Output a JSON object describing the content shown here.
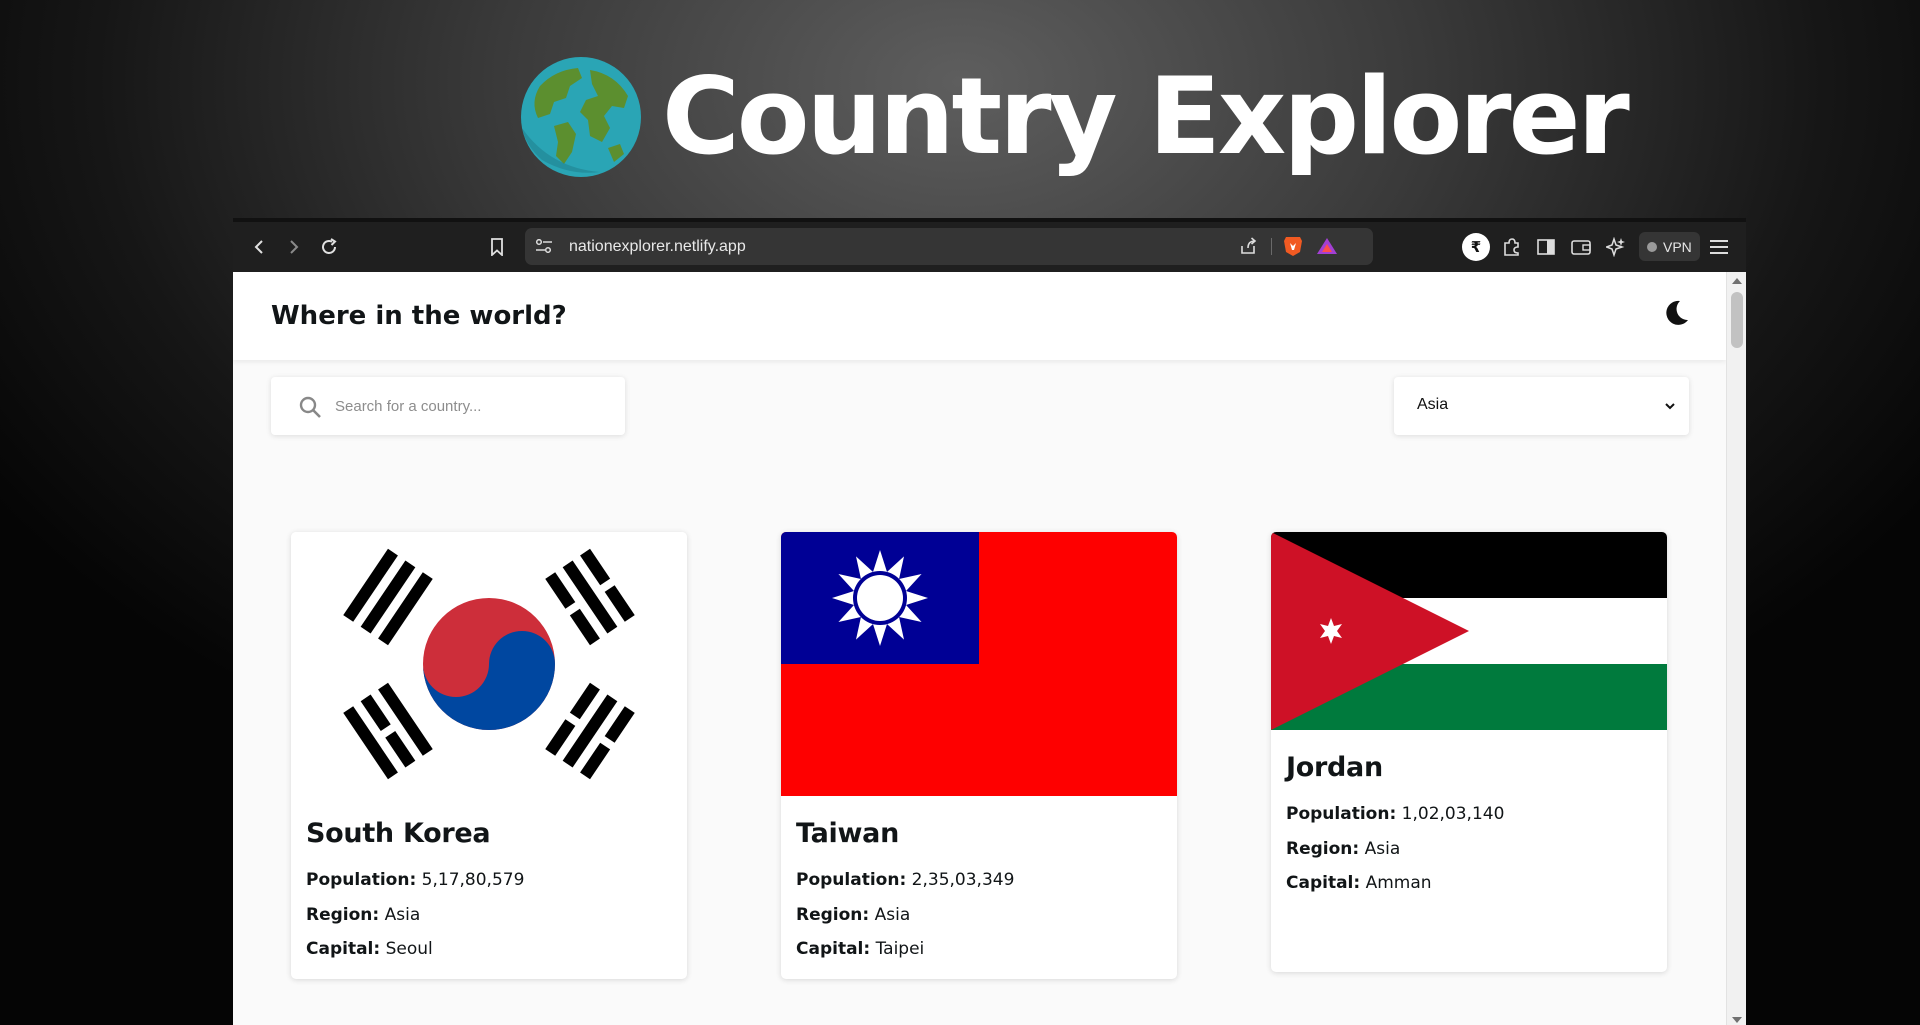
{
  "hero": {
    "title": "Country Explorer",
    "icon": "globe-icon"
  },
  "browser": {
    "url": "nationexplorer.netlify.app",
    "vpn_label": "VPN"
  },
  "site": {
    "title": "Where in the world?",
    "theme_toggle_icon": "moon-icon"
  },
  "search": {
    "placeholder": "Search for a country...",
    "value": ""
  },
  "filter": {
    "selected": "Asia"
  },
  "cards": [
    {
      "name": "South Korea",
      "population_label": "Population:",
      "population": "5,17,80,579",
      "region_label": "Region:",
      "region": "Asia",
      "capital_label": "Capital:",
      "capital": "Seoul",
      "flag": "south-korea-flag"
    },
    {
      "name": "Taiwan",
      "population_label": "Population:",
      "population": "2,35,03,349",
      "region_label": "Region:",
      "region": "Asia",
      "capital_label": "Capital:",
      "capital": "Taipei",
      "flag": "taiwan-flag"
    },
    {
      "name": "Jordan",
      "population_label": "Population:",
      "population": "1,02,03,140",
      "region_label": "Region:",
      "region": "Asia",
      "capital_label": "Capital:",
      "capital": "Amman",
      "flag": "jordan-flag"
    }
  ],
  "colors": {
    "page_bg": "#fafafa",
    "text": "#111517",
    "toolbar": "#1f1f1f"
  }
}
